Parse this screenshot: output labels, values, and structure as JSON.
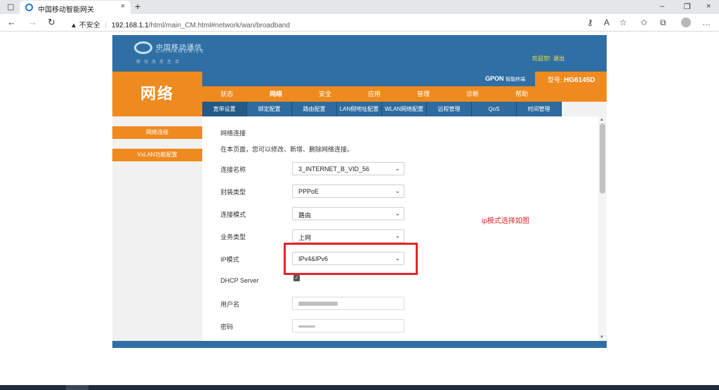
{
  "browser": {
    "tab_title": "中国移动智能网关",
    "tab_close": "×",
    "new_tab": "+",
    "window_controls": {
      "minimize": "–",
      "restore": "❐",
      "close": "×"
    },
    "nav": {
      "back": "←",
      "forward": "→",
      "reload": "↻"
    },
    "url_warning": "▲ 不安全",
    "url_separator": "|",
    "url_host": "192.168.1.1",
    "url_path": "/html/main_CM.html#network/wan/broadband",
    "toolbar_icons": [
      "key-icon",
      "read-aloud-icon",
      "favorite-add-icon",
      "favorites-icon",
      "collections-icon",
      "profile-icon"
    ]
  },
  "header": {
    "logo_cn": "中国移动通信",
    "logo_en": "CHINAMOBILE",
    "logo_slogan": "移动改变生活",
    "welcome": "欢迎您!",
    "logout": "退出",
    "product_main": "GPON",
    "product_sub": "智能终端",
    "model_label": "型号:",
    "model_value": "HG6145D",
    "section_title": "网络"
  },
  "main_nav": {
    "active": "网络",
    "items": [
      "状态",
      "网络",
      "安全",
      "应用",
      "管理",
      "诊断",
      "帮助"
    ]
  },
  "sub_nav": {
    "active": "宽带设置",
    "items": [
      "宽带设置",
      "绑定配置",
      "路由配置",
      "LAN侧地址配置",
      "WLAN网络配置",
      "远程管理",
      "QoS",
      "时间管理"
    ]
  },
  "left_menu": {
    "items": [
      "网络连接",
      "VxLAN功能配置"
    ]
  },
  "content": {
    "title": "网络连接",
    "description": "在本页面，您可以修改、新增、删除网络连接。",
    "fields": {
      "conn_name": {
        "label": "连接名称",
        "value": "3_INTERNET_B_VID_56"
      },
      "encap": {
        "label": "封装类型",
        "value": "PPPoE"
      },
      "mode": {
        "label": "连接模式",
        "value": "路由"
      },
      "service": {
        "label": "业务类型",
        "value": "上网"
      },
      "ip_mode": {
        "label": "IP模式",
        "value": "IPv4&IPv6"
      },
      "dhcp": {
        "label": "DHCP Server",
        "checked": true
      },
      "username": {
        "label": "用户名",
        "value": ""
      },
      "password": {
        "label": "密码",
        "value": ""
      }
    },
    "annotation": "ip模式选择如图",
    "highlight_color": "#e1262b"
  },
  "colors": {
    "brand_blue": "#2f6fa4",
    "brand_orange": "#ef8a1f"
  }
}
